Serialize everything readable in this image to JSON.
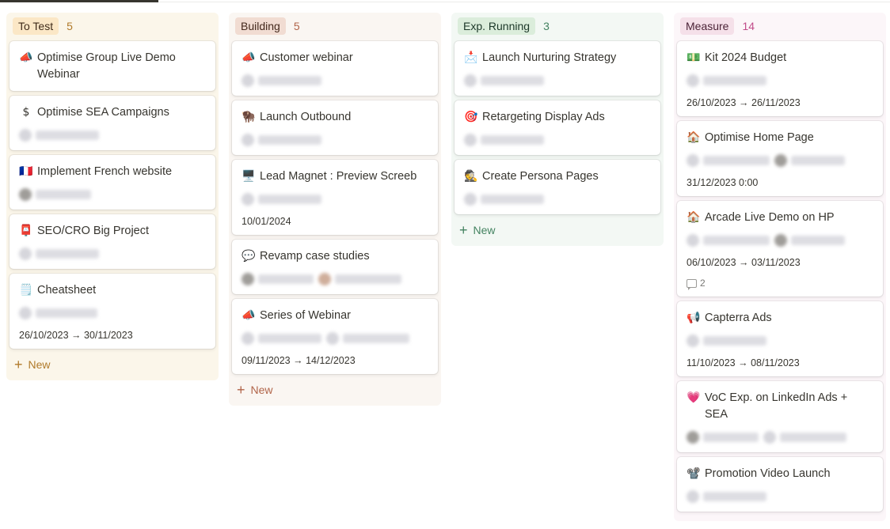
{
  "columns": [
    {
      "name": "To Test",
      "count": "5",
      "colors": {
        "bg": "#fbf6ea",
        "pill": "#fbe7c6",
        "pill_text": "#402c1b",
        "count": "#b07a2a",
        "new": "#b07a2a"
      },
      "new_label": "New",
      "cards": [
        {
          "emoji": "📣",
          "title": "Optimise Group Live Demo Webinar",
          "people": []
        },
        {
          "emoji": "$",
          "title": "Optimise SEA Campaigns",
          "people": [
            {
              "avatar": "light",
              "w": 80
            }
          ]
        },
        {
          "emoji": "🇫🇷",
          "title": "Implement French website",
          "people": [
            {
              "avatar": "dark",
              "w": 70
            }
          ]
        },
        {
          "emoji": "📮",
          "title": "SEO/CRO Big Project",
          "people": [
            {
              "avatar": "light",
              "w": 80
            }
          ]
        },
        {
          "emoji": "🗒️",
          "title": "Cheatsheet",
          "people": [
            {
              "avatar": "light",
              "w": 78
            }
          ],
          "date": "26/10/2023 → 30/11/2023"
        }
      ]
    },
    {
      "name": "Building",
      "count": "5",
      "colors": {
        "bg": "#faf6f2",
        "pill": "#f1dcd2",
        "pill_text": "#44291d",
        "count": "#b1654a",
        "new": "#b1654a"
      },
      "new_label": "New",
      "cards": [
        {
          "emoji": "📣",
          "title": "Customer webinar",
          "people": [
            {
              "avatar": "light",
              "w": 80
            }
          ]
        },
        {
          "emoji": "🦬",
          "title": "Launch Outbound",
          "people": [
            {
              "avatar": "light",
              "w": 80
            }
          ]
        },
        {
          "emoji": "🖥️",
          "title": "Lead Magnet : Preview Screeb",
          "people": [
            {
              "avatar": "light",
              "w": 80
            }
          ],
          "date": "10/01/2024"
        },
        {
          "emoji": "💬",
          "title": "Revamp case studies",
          "people": [
            {
              "avatar": "dark",
              "w": 70
            },
            {
              "avatar": "brown",
              "w": 84
            }
          ]
        },
        {
          "emoji": "📣",
          "title": "Series of Webinar",
          "people": [
            {
              "avatar": "light",
              "w": 80
            },
            {
              "avatar": "light",
              "w": 84
            }
          ],
          "date": "09/11/2023 → 14/12/2023"
        }
      ]
    },
    {
      "name": "Exp. Running",
      "count": "3",
      "colors": {
        "bg": "#f3f8f4",
        "pill": "#dbeddb",
        "pill_text": "#1c3829",
        "count": "#448361",
        "new": "#448361"
      },
      "new_label": "New",
      "cards": [
        {
          "emoji": "📩",
          "title": "Launch Nurturing Strategy",
          "people": [
            {
              "avatar": "light",
              "w": 80
            }
          ]
        },
        {
          "emoji": "🎯",
          "title": "Retargeting Display Ads",
          "people": [
            {
              "avatar": "light",
              "w": 80
            }
          ]
        },
        {
          "emoji": "🕵️",
          "title": "Create Persona Pages",
          "people": [
            {
              "avatar": "light",
              "w": 80
            }
          ]
        }
      ]
    },
    {
      "name": "Measure",
      "count": "14",
      "colors": {
        "bg": "#fcf6f9",
        "pill": "#f5e0e9",
        "pill_text": "#4c2337",
        "count": "#c14c8a",
        "new": "#c14c8a"
      },
      "new_label": "",
      "cards": [
        {
          "emoji": "💵",
          "title": "Kit 2024 Budget",
          "people": [
            {
              "avatar": "light",
              "w": 80
            }
          ],
          "date": "26/10/2023 → 26/11/2023"
        },
        {
          "emoji": "🏠",
          "title": "Optimise Home Page",
          "people": [
            {
              "avatar": "light",
              "w": 84
            },
            {
              "avatar": "dark",
              "w": 68
            }
          ],
          "date": "31/12/2023 0:00"
        },
        {
          "emoji": "🏠",
          "title": "Arcade Live Demo on HP",
          "people": [
            {
              "avatar": "light",
              "w": 84
            },
            {
              "avatar": "dark",
              "w": 68
            }
          ],
          "date": "06/10/2023 → 03/11/2023",
          "comments": "2"
        },
        {
          "emoji": "📢",
          "title": "Capterra Ads",
          "people": [
            {
              "avatar": "light",
              "w": 80
            }
          ],
          "date": "11/10/2023 → 08/11/2023"
        },
        {
          "emoji": "💗",
          "title": "VoC Exp. on LinkedIn Ads + SEA",
          "people": [
            {
              "avatar": "dark",
              "w": 70
            },
            {
              "avatar": "light",
              "w": 84
            }
          ]
        },
        {
          "emoji": "📽️",
          "title": "Promotion Video Launch",
          "people": [
            {
              "avatar": "light",
              "w": 80
            }
          ]
        }
      ]
    }
  ]
}
